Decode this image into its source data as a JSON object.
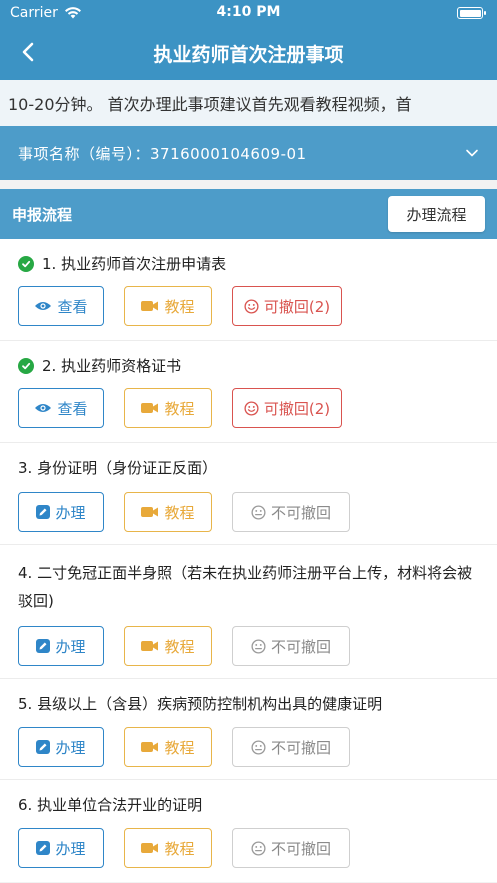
{
  "status_bar": {
    "carrier": "Carrier",
    "time": "4:10 PM"
  },
  "navbar": {
    "title": "执业药师首次注册事项"
  },
  "notice": {
    "text": "10-20分钟。  首次办理此事项建议首先观看教程视频，首"
  },
  "matter": {
    "label": "事项名称（编号）：3716000104609-01"
  },
  "flow": {
    "title": "申报流程",
    "button": "办理流程"
  },
  "items": [
    {
      "title": "1. 执业药师首次注册申请表",
      "done": true,
      "action": "查看",
      "tutorial": "教程",
      "revoke": "可撤回(2)",
      "revocable": true
    },
    {
      "title": "2. 执业药师资格证书",
      "done": true,
      "action": "查看",
      "tutorial": "教程",
      "revoke": "可撤回(2)",
      "revocable": true
    },
    {
      "title": "3. 身份证明（身份证正反面）",
      "done": false,
      "action": "办理",
      "tutorial": "教程",
      "revoke": "不可撤回",
      "revocable": false
    },
    {
      "title": "4. 二寸免冠正面半身照（若未在执业药师注册平台上传，材料将会被驳回)",
      "done": false,
      "action": "办理",
      "tutorial": "教程",
      "revoke": "不可撤回",
      "revocable": false
    },
    {
      "title": "5. 县级以上（含县）疾病预防控制机构出具的健康证明",
      "done": false,
      "action": "办理",
      "tutorial": "教程",
      "revoke": "不可撤回",
      "revocable": false
    },
    {
      "title": "6. 执业单位合法开业的证明",
      "done": false,
      "action": "办理",
      "tutorial": "教程",
      "revoke": "不可撤回",
      "revocable": false
    }
  ],
  "colors": {
    "header": "#3c93c4",
    "bar": "#4d9cc9",
    "primary": "#2f86c8",
    "tutorial": "#e8b54a",
    "revoke": "#d9534f",
    "done": "#27a844"
  }
}
